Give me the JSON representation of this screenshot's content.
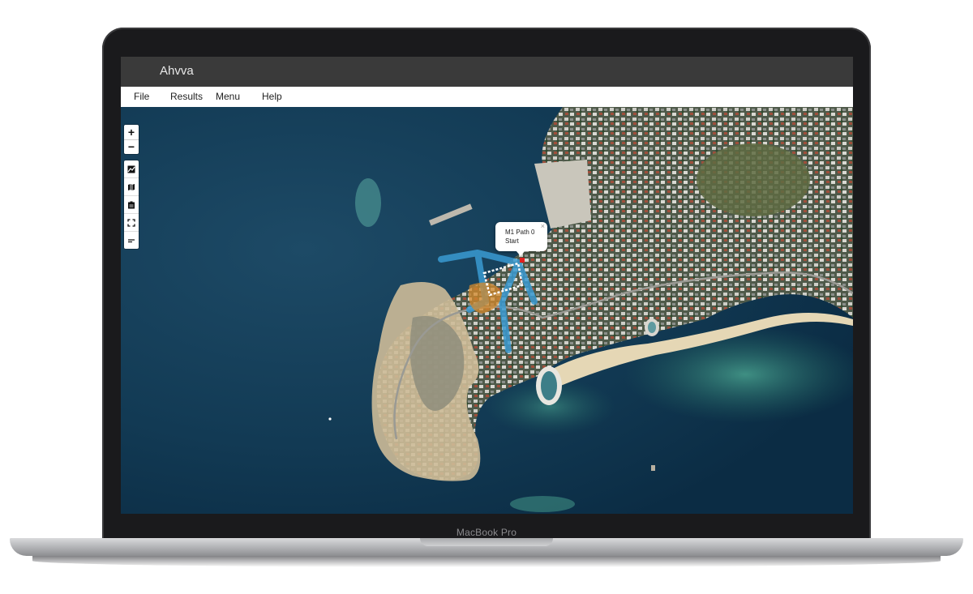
{
  "app": {
    "title": "Ahvva"
  },
  "menu": {
    "items": [
      {
        "label": "File"
      },
      {
        "label": "Results"
      },
      {
        "label": "Menu"
      },
      {
        "label": "Help"
      }
    ]
  },
  "map_controls": {
    "zoom_in": "+",
    "zoom_out": "−",
    "tools": [
      "image-icon",
      "map-icon",
      "clipboard-icon",
      "fullscreen-icon",
      "list-icon"
    ]
  },
  "popup": {
    "title": "M1 Path 0",
    "subtitle": "Start",
    "close": "×"
  },
  "device": {
    "brand": "MacBook Pro"
  },
  "colors": {
    "titlebar": "#3a3a3a",
    "path": "#3a9ad1",
    "start_marker": "#e02020",
    "sea": "#0f3145"
  }
}
